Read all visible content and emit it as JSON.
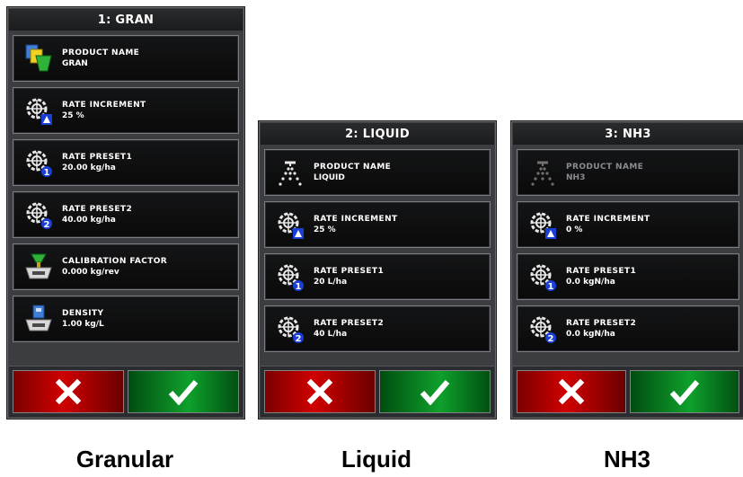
{
  "panels": [
    {
      "id": "gran",
      "title": "1: GRAN",
      "caption": "Granular",
      "rows": [
        {
          "icon": "product-bag-icon",
          "label": "PRODUCT NAME",
          "value": "GRAN"
        },
        {
          "icon": "rate-increment-icon",
          "label": "RATE INCREMENT",
          "value": "25 %"
        },
        {
          "icon": "rate-preset-1-icon",
          "label": "RATE PRESET1",
          "value": "20.00 kg/ha"
        },
        {
          "icon": "rate-preset-2-icon",
          "label": "RATE PRESET2",
          "value": "40.00 kg/ha"
        },
        {
          "icon": "calibration-scale-icon",
          "label": "CALIBRATION FACTOR",
          "value": "0.000 kg/rev"
        },
        {
          "icon": "density-scale-icon",
          "label": "DENSITY",
          "value": "1.00 kg/L"
        }
      ]
    },
    {
      "id": "liquid",
      "title": "2: LIQUID",
      "caption": "Liquid",
      "rows": [
        {
          "icon": "spray-nozzle-icon",
          "label": "PRODUCT NAME",
          "value": "LIQUID"
        },
        {
          "icon": "rate-increment-icon",
          "label": "RATE INCREMENT",
          "value": "25 %"
        },
        {
          "icon": "rate-preset-1-icon",
          "label": "RATE PRESET1",
          "value": "20 L/ha"
        },
        {
          "icon": "rate-preset-2-icon",
          "label": "RATE PRESET2",
          "value": "40 L/ha"
        }
      ]
    },
    {
      "id": "nh3",
      "title": "3: NH3",
      "caption": "NH3",
      "rows": [
        {
          "icon": "spray-nozzle-icon",
          "label": "PRODUCT NAME",
          "value": "NH3",
          "disabled": true
        },
        {
          "icon": "rate-increment-icon",
          "label": "RATE INCREMENT",
          "value": "0 %"
        },
        {
          "icon": "rate-preset-1-icon",
          "label": "RATE PRESET1",
          "value": "0.0 kgN/ha"
        },
        {
          "icon": "rate-preset-2-icon",
          "label": "RATE PRESET2",
          "value": "0.0 kgN/ha"
        }
      ]
    }
  ],
  "buttons": {
    "cancel_icon": "x-icon",
    "confirm_icon": "check-icon"
  },
  "colors": {
    "panel_bg": "#3c3d40",
    "row_bg": "#111213",
    "cancel_red": "#d00000",
    "confirm_green": "#0fa02c",
    "badge_blue": "#1a3fd6"
  }
}
